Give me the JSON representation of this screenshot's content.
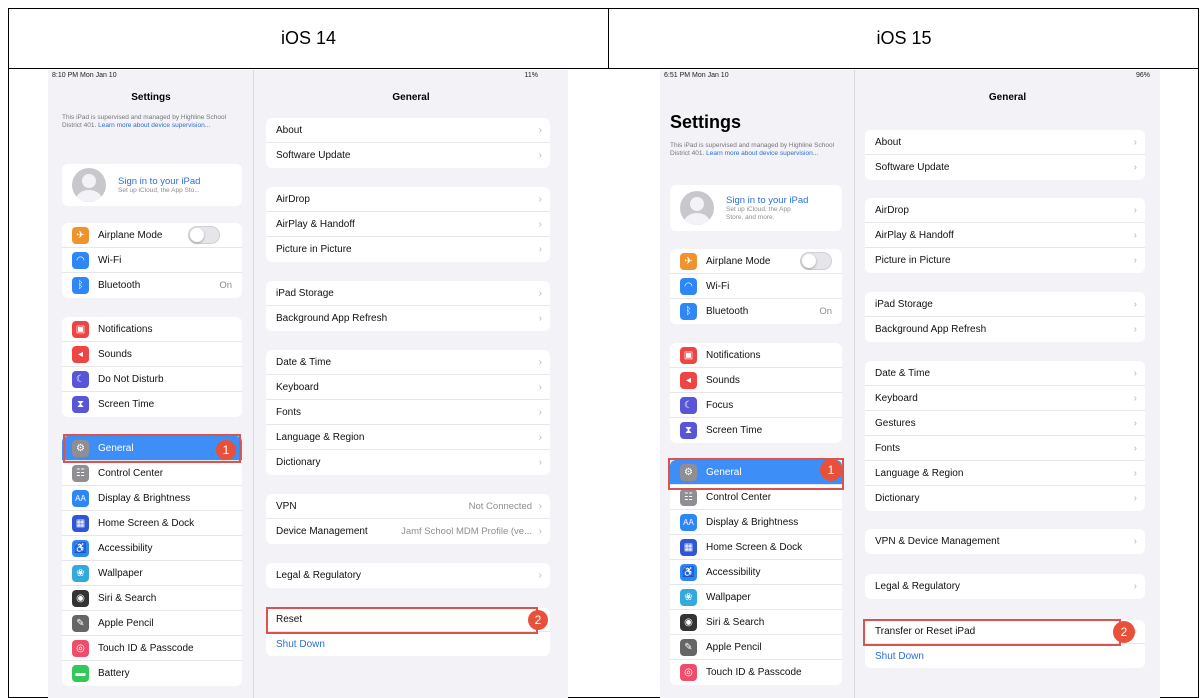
{
  "columns": {
    "left": "iOS 14",
    "right": "iOS 15"
  },
  "ios14": {
    "status_left": "8:10 PM  Mon Jan 10",
    "status_right": "11%",
    "sidebar_title": "Settings",
    "supervision_text": "This iPad is supervised and managed by Highline School District 401.",
    "supervision_link": "Learn more about device supervision...",
    "signin_title": "Sign in to your iPad",
    "signin_sub": "Set up iCloud, the App Sto...",
    "connectivity": [
      {
        "label": "Airplane Mode",
        "icon": "airplane-icon",
        "color": "#f0932b"
      },
      {
        "label": "Wi-Fi",
        "icon": "wifi-icon",
        "color": "#2f86f6"
      },
      {
        "label": "Bluetooth",
        "icon": "bluetooth-icon",
        "color": "#2f86f6",
        "value": "On"
      }
    ],
    "notif": [
      {
        "label": "Notifications",
        "icon": "notifications-icon",
        "color": "#ef4444"
      },
      {
        "label": "Sounds",
        "icon": "sounds-icon",
        "color": "#ef4444"
      },
      {
        "label": "Do Not Disturb",
        "icon": "moon-icon",
        "color": "#5856d6"
      },
      {
        "label": "Screen Time",
        "icon": "hourglass-icon",
        "color": "#5856d6"
      }
    ],
    "general": [
      {
        "label": "General",
        "icon": "gear-icon",
        "color": "#8e8e93"
      },
      {
        "label": "Control Center",
        "icon": "control-center-icon",
        "color": "#8e8e93"
      },
      {
        "label": "Display & Brightness",
        "icon": "display-icon",
        "color": "#2f86f6"
      },
      {
        "label": "Home Screen & Dock",
        "icon": "home-screen-icon",
        "color": "#2f56d6"
      },
      {
        "label": "Accessibility",
        "icon": "accessibility-icon",
        "color": "#2f86f6"
      },
      {
        "label": "Wallpaper",
        "icon": "wallpaper-icon",
        "color": "#34aadc"
      },
      {
        "label": "Siri & Search",
        "icon": "siri-icon",
        "color": "#333"
      },
      {
        "label": "Apple Pencil",
        "icon": "pencil-icon",
        "color": "#666"
      },
      {
        "label": "Touch ID & Passcode",
        "icon": "fingerprint-icon",
        "color": "#ef4d6a"
      },
      {
        "label": "Battery",
        "icon": "battery-icon",
        "color": "#34c759"
      }
    ],
    "main_title": "General",
    "g1": [
      "About",
      "Software Update"
    ],
    "g2": [
      "AirDrop",
      "AirPlay & Handoff",
      "Picture in Picture"
    ],
    "g3": [
      "iPad Storage",
      "Background App Refresh"
    ],
    "g4": [
      "Date & Time",
      "Keyboard",
      "Fonts",
      "Language & Region",
      "Dictionary"
    ],
    "vpn_label": "VPN",
    "vpn_value": "Not Connected",
    "devmgmt_label": "Device Management",
    "devmgmt_value": "Jamf School MDM Profile (ve...",
    "legal": "Legal & Regulatory",
    "reset": "Reset",
    "shutdown": "Shut Down",
    "badge1": "1",
    "badge2": "2"
  },
  "ios15": {
    "status_left": "6:51 PM  Mon Jan 10",
    "status_right": "96%",
    "sidebar_title": "Settings",
    "supervision_text": "This iPad is supervised and managed by Highline School District 401.",
    "supervision_link": "Learn more about device supervision...",
    "signin_title": "Sign in to your iPad",
    "signin_sub": "Set up iCloud, the App Store, and more.",
    "connectivity": [
      {
        "label": "Airplane Mode",
        "icon": "airplane-icon",
        "color": "#f0932b"
      },
      {
        "label": "Wi-Fi",
        "icon": "wifi-icon",
        "color": "#2f86f6"
      },
      {
        "label": "Bluetooth",
        "icon": "bluetooth-icon",
        "color": "#2f86f6",
        "value": "On"
      }
    ],
    "notif": [
      {
        "label": "Notifications",
        "icon": "notifications-icon",
        "color": "#ef4444"
      },
      {
        "label": "Sounds",
        "icon": "sounds-icon",
        "color": "#ef4444"
      },
      {
        "label": "Focus",
        "icon": "moon-icon",
        "color": "#5856d6"
      },
      {
        "label": "Screen Time",
        "icon": "hourglass-icon",
        "color": "#5856d6"
      }
    ],
    "general": [
      {
        "label": "General",
        "icon": "gear-icon",
        "color": "#8e8e93"
      },
      {
        "label": "Control Center",
        "icon": "control-center-icon",
        "color": "#8e8e93"
      },
      {
        "label": "Display & Brightness",
        "icon": "display-icon",
        "color": "#2f86f6"
      },
      {
        "label": "Home Screen & Dock",
        "icon": "home-screen-icon",
        "color": "#2f56d6"
      },
      {
        "label": "Accessibility",
        "icon": "accessibility-icon",
        "color": "#2f86f6"
      },
      {
        "label": "Wallpaper",
        "icon": "wallpaper-icon",
        "color": "#34aadc"
      },
      {
        "label": "Siri & Search",
        "icon": "siri-icon",
        "color": "#333"
      },
      {
        "label": "Apple Pencil",
        "icon": "pencil-icon",
        "color": "#666"
      },
      {
        "label": "Touch ID & Passcode",
        "icon": "fingerprint-icon",
        "color": "#ef4d6a"
      }
    ],
    "main_title": "General",
    "g1": [
      "About",
      "Software Update"
    ],
    "g2": [
      "AirDrop",
      "AirPlay & Handoff",
      "Picture in Picture"
    ],
    "g3": [
      "iPad Storage",
      "Background App Refresh"
    ],
    "g4": [
      "Date & Time",
      "Keyboard",
      "Gestures",
      "Fonts",
      "Language & Region",
      "Dictionary"
    ],
    "vpn": "VPN & Device Management",
    "legal": "Legal & Regulatory",
    "reset": "Transfer or Reset iPad",
    "shutdown": "Shut Down",
    "badge1": "1",
    "badge2": "2"
  }
}
